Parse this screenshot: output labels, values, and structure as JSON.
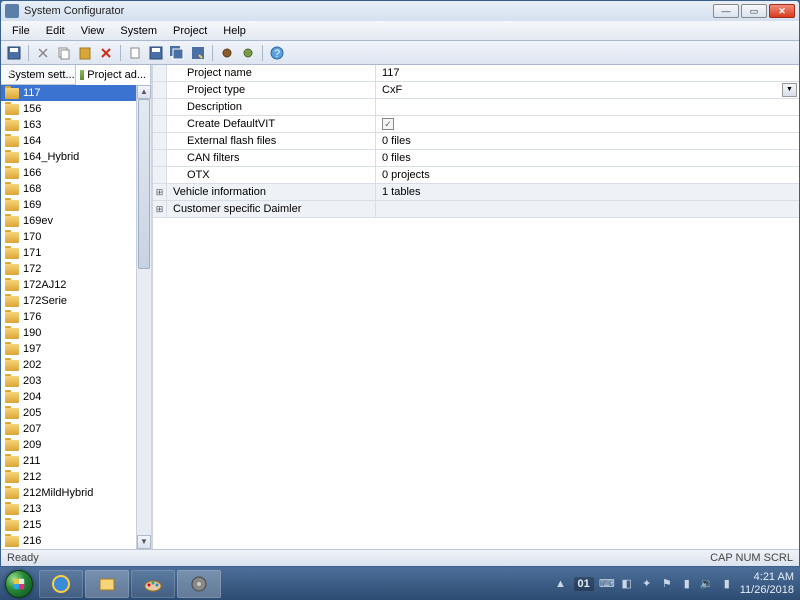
{
  "window": {
    "title": "System Configurator"
  },
  "menu": {
    "items": [
      "File",
      "Edit",
      "View",
      "System",
      "Project",
      "Help"
    ]
  },
  "toolbar": {
    "icons": [
      "save",
      "cut",
      "copy",
      "paste",
      "delete",
      "",
      "new",
      "save2",
      "saveall",
      "saveas",
      "",
      "gear1",
      "gear2",
      "",
      "help"
    ]
  },
  "tabs": {
    "left": "System sett...",
    "right": "Project ad..."
  },
  "tree": [
    "117",
    "156",
    "163",
    "164",
    "164_Hybrid",
    "166",
    "168",
    "169",
    "169ev",
    "170",
    "171",
    "172",
    "172AJ12",
    "172Serie",
    "176",
    "190",
    "197",
    "202",
    "203",
    "204",
    "205",
    "207",
    "209",
    "211",
    "212",
    "212MildHybrid",
    "213",
    "215",
    "216"
  ],
  "properties": {
    "rows": [
      {
        "name": "Project name",
        "value": "117",
        "type": "text"
      },
      {
        "name": "Project type",
        "value": "CxF",
        "type": "dropdown"
      },
      {
        "name": "Description",
        "value": "",
        "type": "text"
      },
      {
        "name": "Create DefaultVIT",
        "value": "checked",
        "type": "check"
      },
      {
        "name": "External flash files",
        "value": "0 files",
        "type": "text"
      },
      {
        "name": "CAN filters",
        "value": "0 files",
        "type": "text"
      },
      {
        "name": "OTX",
        "value": "0 projects",
        "type": "text"
      }
    ],
    "groups": [
      {
        "name": "Vehicle information",
        "value": "1 tables"
      },
      {
        "name": "Customer specific Daimler",
        "value": ""
      }
    ]
  },
  "status": {
    "left": "Ready",
    "right": "CAP  NUM  SCRL"
  },
  "systray": {
    "lang": "01",
    "time": "4:21 AM",
    "date": "11/26/2018"
  }
}
